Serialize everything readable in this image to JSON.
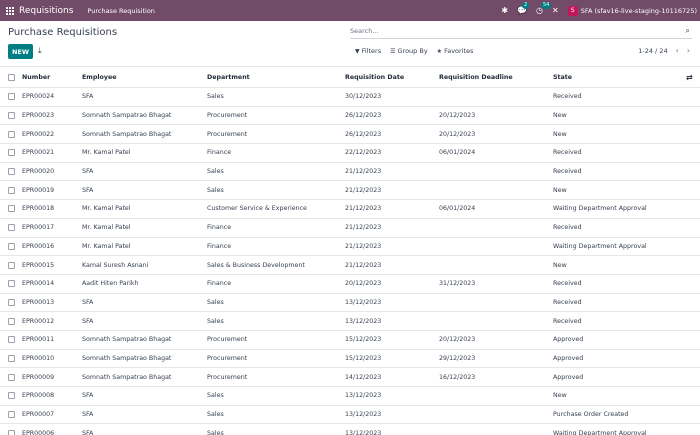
{
  "navbar": {
    "app_title": "Requisitions",
    "menu_item": "Purchase Requisition",
    "chat_badge": "2",
    "activity_badge": "54",
    "avatar_letter": "S",
    "user_label": "SFA (sfav16-live-staging-10116725)"
  },
  "control": {
    "breadcrumb": "Purchase Requisitions",
    "new_label": "NEW",
    "search_placeholder": "Search...",
    "filters_label": "Filters",
    "groupby_label": "Group By",
    "favorites_label": "Favorites",
    "pager": "1-24 / 24"
  },
  "columns": {
    "number": "Number",
    "employee": "Employee",
    "department": "Department",
    "requisition_date": "Requisition Date",
    "requisition_deadline": "Requisition Deadline",
    "state": "State"
  },
  "rows": [
    [
      "EPR00024",
      "SFA",
      "Sales",
      "30/12/2023",
      "",
      "Received"
    ],
    [
      "EPR00023",
      "Somnath Sampatrao Bhagat",
      "Procurement",
      "26/12/2023",
      "20/12/2023",
      "New"
    ],
    [
      "EPR00022",
      "Somnath Sampatrao Bhagat",
      "Procurement",
      "26/12/2023",
      "20/12/2023",
      "New"
    ],
    [
      "EPR00021",
      "Mr. Kamal Patel",
      "Finance",
      "22/12/2023",
      "06/01/2024",
      "Received"
    ],
    [
      "EPR00020",
      "SFA",
      "Sales",
      "21/12/2023",
      "",
      "Received"
    ],
    [
      "EPR00019",
      "SFA",
      "Sales",
      "21/12/2023",
      "",
      "New"
    ],
    [
      "EPR00018",
      "Mr. Kamal Patel",
      "Customer Service & Experience",
      "21/12/2023",
      "06/01/2024",
      "Waiting Department Approval"
    ],
    [
      "EPR00017",
      "Mr. Kamal Patel",
      "Finance",
      "21/12/2023",
      "",
      "Received"
    ],
    [
      "EPR00016",
      "Mr. Kamal Patel",
      "Finance",
      "21/12/2023",
      "",
      "Waiting Department Approval"
    ],
    [
      "EPR00015",
      "Kamal Suresh Asnani",
      "Sales & Business Development",
      "21/12/2023",
      "",
      "New"
    ],
    [
      "EPR00014",
      "Aadit Hiten Parikh",
      "Finance",
      "20/12/2023",
      "31/12/2023",
      "Received"
    ],
    [
      "EPR00013",
      "SFA",
      "Sales",
      "13/12/2023",
      "",
      "Received"
    ],
    [
      "EPR00012",
      "SFA",
      "Sales",
      "13/12/2023",
      "",
      "Received"
    ],
    [
      "EPR00011",
      "Somnath Sampatrao Bhagat",
      "Procurement",
      "15/12/2023",
      "20/12/2023",
      "Approved"
    ],
    [
      "EPR00010",
      "Somnath Sampatrao Bhagat",
      "Procurement",
      "15/12/2023",
      "29/12/2023",
      "Approved"
    ],
    [
      "EPR00009",
      "Somnath Sampatrao Bhagat",
      "Procurement",
      "14/12/2023",
      "16/12/2023",
      "Approved"
    ],
    [
      "EPR00008",
      "SFA",
      "Sales",
      "13/12/2023",
      "",
      "New"
    ],
    [
      "EPR00007",
      "SFA",
      "Sales",
      "13/12/2023",
      "",
      "Purchase Order Created"
    ],
    [
      "EPR00006",
      "SFA",
      "Sales",
      "13/12/2023",
      "",
      "Waiting Department Approval"
    ]
  ],
  "colors": {
    "navbar": "#714b67",
    "primary": "#017e84"
  }
}
